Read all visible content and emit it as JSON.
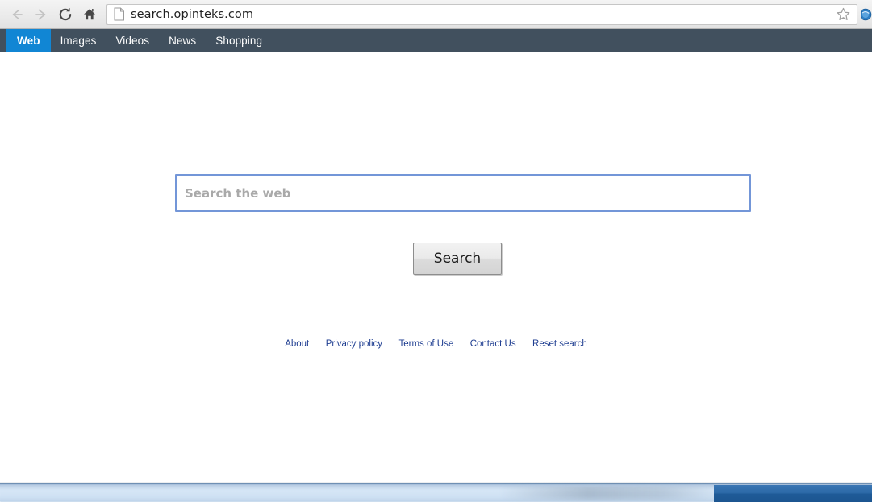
{
  "browser": {
    "back_icon": "arrow-left-icon",
    "forward_icon": "arrow-right-icon",
    "reload_icon": "reload-icon",
    "home_icon": "home-icon",
    "page_icon": "page-document-icon",
    "url": "search.opinteks.com",
    "bookmark_icon": "star-outline-icon",
    "extension_icon": "extension-circle-icon"
  },
  "site_nav": {
    "items": [
      {
        "label": "Web",
        "active": true
      },
      {
        "label": "Images",
        "active": false
      },
      {
        "label": "Videos",
        "active": false
      },
      {
        "label": "News",
        "active": false
      },
      {
        "label": "Shopping",
        "active": false
      }
    ]
  },
  "search": {
    "value": "",
    "placeholder": "Search the web",
    "button_label": "Search"
  },
  "footer": {
    "links": [
      {
        "label": "About"
      },
      {
        "label": "Privacy policy"
      },
      {
        "label": "Terms of Use"
      },
      {
        "label": "Contact Us"
      },
      {
        "label": "Reset search"
      }
    ]
  },
  "colors": {
    "nav_bar_bg": "#41505e",
    "nav_active_bg": "#1186d4",
    "search_border": "#7396d8",
    "footer_link": "#1f3e91",
    "placeholder": "#a9a9a9"
  }
}
